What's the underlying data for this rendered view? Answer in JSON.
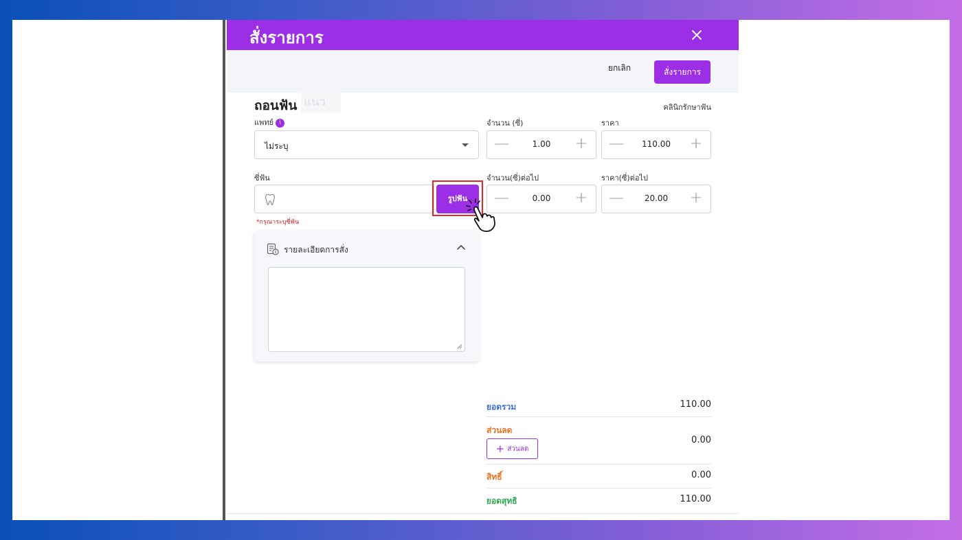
{
  "modal": {
    "title": "สั่งรายการ",
    "close_icon": "close-icon"
  },
  "actions": {
    "cancel_label": "ยกเลิก",
    "order_label": "สั่งรายการ"
  },
  "item": {
    "title": "ถอนฟัน",
    "title_ghost": "แนว",
    "clinic_label": "คลินิกรักษาฟัน"
  },
  "doctor": {
    "label": "แพทย์",
    "info_icon": "info-icon",
    "value": "ไม่ระบุ"
  },
  "quantity": {
    "label": "จำนวน (ซี่)",
    "value": "1.00"
  },
  "price": {
    "label": "ราคา",
    "value": "110.00"
  },
  "tooth": {
    "label": "ซี่ฟัน",
    "button_label": "รูปฟัน",
    "error": "*กรุณาระบุซี่ฟัน"
  },
  "next_quantity": {
    "label": "จำนวน(ซี่)ต่อไป",
    "value": "0.00"
  },
  "next_price": {
    "label": "ราคา(ซี่)ต่อไป",
    "value": "20.00"
  },
  "details": {
    "title": "รายละเอียดการสั่ง",
    "text": ""
  },
  "summary": {
    "total_label": "ยอดรวม",
    "total_value": "110.00",
    "discount_label": "ส่วนลด",
    "discount_value": "0.00",
    "discount_button": "ส่วนลด",
    "rights_label": "สิทธิ์",
    "rights_value": "0.00",
    "net_label": "ยอดสุทธิ",
    "net_value": "110.00"
  },
  "colors": {
    "primary": "#9c2ee6",
    "total": "#3b6fd8",
    "discount": "#e8741f",
    "rights": "#e8741f",
    "net": "#2fa84f",
    "error": "#d11a1a",
    "highlight": "#e3262b"
  }
}
